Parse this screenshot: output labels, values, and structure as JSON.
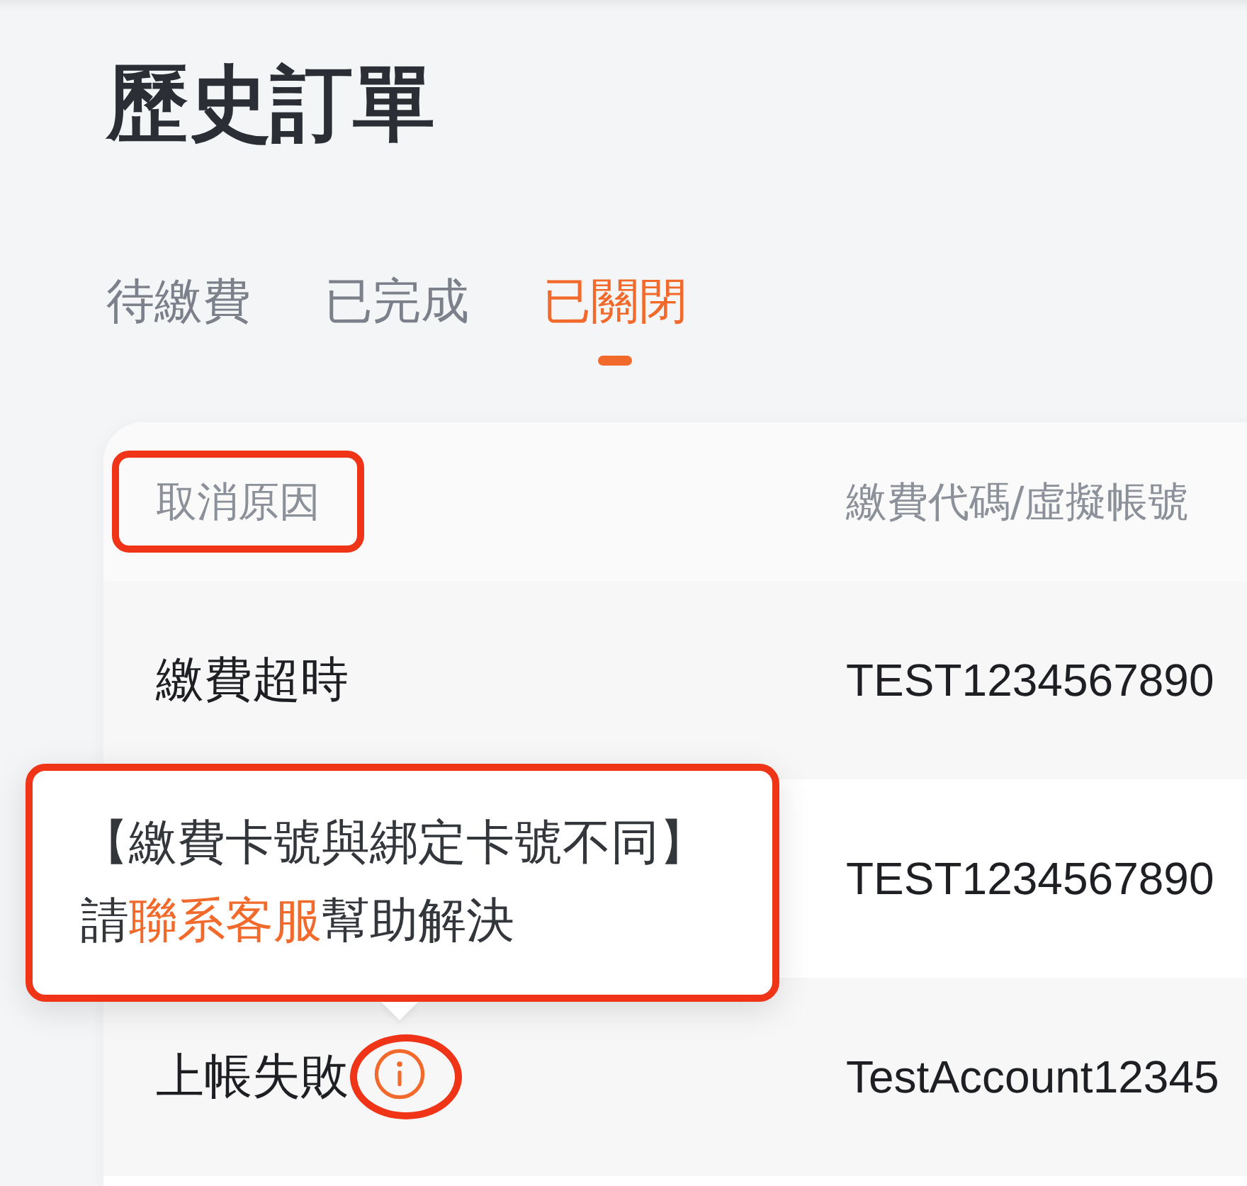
{
  "page": {
    "title": "歷史訂單"
  },
  "tabs": [
    {
      "label": "待繳費",
      "selected": false
    },
    {
      "label": "已完成",
      "selected": false
    },
    {
      "label": "已關閉",
      "selected": true
    }
  ],
  "table": {
    "columns": [
      {
        "label": "取消原因",
        "highlighted": true
      },
      {
        "label": "繳費代碼/虛擬帳號",
        "highlighted": false
      }
    ],
    "rows": [
      {
        "reason": "繳費超時",
        "code": "TEST1234567890"
      },
      {
        "code": "TEST1234567890"
      },
      {
        "reason": "上帳失敗",
        "code": "TestAccount12345",
        "info": {
          "highlighted": true,
          "tooltip": {
            "highlighted": true,
            "title": "【繳費卡號與綁定卡號不同】",
            "message": {
              "before": "請",
              "link": "聯系客服",
              "after": "幫助解決"
            }
          }
        }
      }
    ]
  }
}
